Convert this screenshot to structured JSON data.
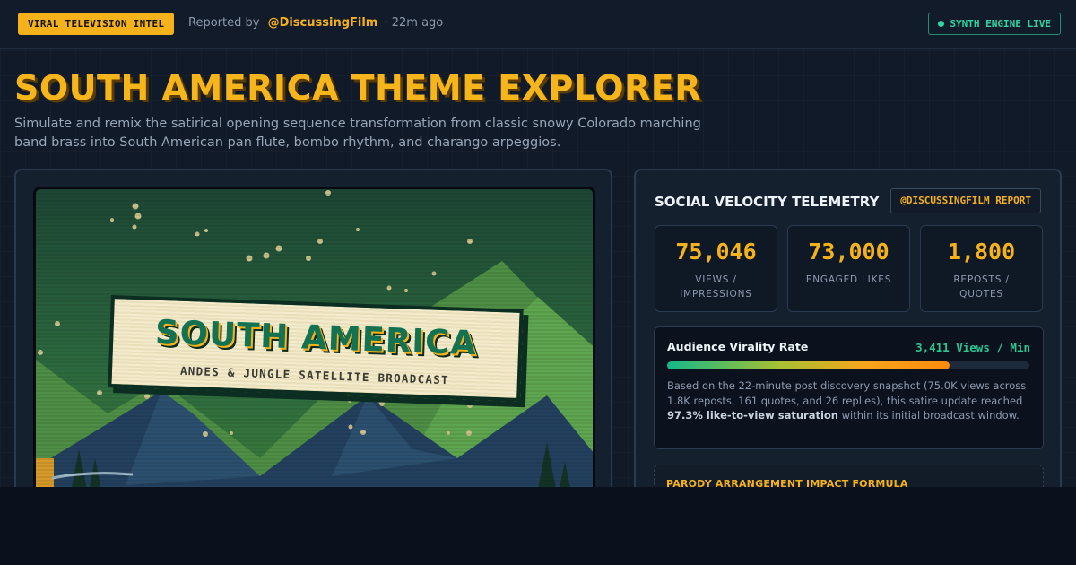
{
  "header": {
    "badge": "VIRAL TELEVISION INTEL",
    "reported_prefix": "Reported by",
    "handle": "@DiscussingFilm",
    "time": "· 22m ago",
    "live_label": "SYNTH ENGINE LIVE"
  },
  "page": {
    "title": "SOUTH AMERICA THEME EXPLORER",
    "subtitle": "Simulate and remix the satirical opening sequence transformation from classic snowy Colorado marching band brass into South American pan flute, bombo rhythm, and charango arpeggios."
  },
  "preview": {
    "banner_title": "SOUTH AMERICA",
    "banner_subtitle": "ANDES & JUNGLE SATELLITE BROADCAST"
  },
  "telemetry": {
    "title": "SOCIAL VELOCITY TELEMETRY",
    "report_button": "@DISCUSSINGFILM REPORT",
    "stats": [
      {
        "value": "75,046",
        "label": "VIEWS / IMPRESSIONS"
      },
      {
        "value": "73,000",
        "label": "ENGAGED LIKES"
      },
      {
        "value": "1,800",
        "label": "REPOSTS / QUOTES"
      }
    ],
    "virality": {
      "title": "Audience Virality Rate",
      "rate": "3,411 Views / Min",
      "bar_percent": 78,
      "desc_before": "Based on the 22-minute post discovery snapshot (75.0K views across 1.8K reposts, 161 quotes, and 26 replies), this satire update reached ",
      "desc_bold": "97.3% like-to-view saturation",
      "desc_after": " within its initial broadcast window."
    },
    "formula_title": "PARODY ARRANGEMENT IMPACT FORMULA"
  },
  "colors": {
    "accent": "#f6b21b",
    "live": "#2fd4a2",
    "panel": "#15202f",
    "background": "#101a28"
  }
}
